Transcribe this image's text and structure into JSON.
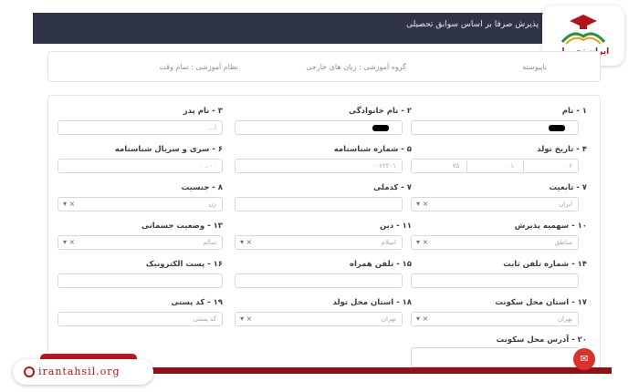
{
  "header": {
    "title": "پذیرش صرفا بر اساس سوابق تحصیلی"
  },
  "logo": {
    "text": "ایران تحصیل"
  },
  "info": {
    "level": "ناپیوسته",
    "group": "گروه آموزشی : زبان های خارجی",
    "system": "نظام آموزشی : تمام وقت"
  },
  "form": {
    "f1": {
      "label": "۱ - نام"
    },
    "f2": {
      "label": "۲ - نام خانوادگی"
    },
    "f3": {
      "label": "۳ - نام پدر",
      "value": "ا..."
    },
    "f4": {
      "label": "۴ - تاریخ تولد",
      "day": "۰۶",
      "month": "۰۱",
      "year": "۷۵"
    },
    "f5": {
      "label": "۵ - شماره شناسنامه",
      "value": "۰۰۶۲۲۰۱"
    },
    "f6": {
      "label": "۶ - سری و سریال شناسنامه",
      "value": "۰۰ ، ۰"
    },
    "f7": {
      "label": "۷ - تابعیت",
      "value": "ایران"
    },
    "f8": {
      "label": "۷ - کدملی"
    },
    "f9": {
      "label": "۸ - جنسیت",
      "value": "زن"
    },
    "f10": {
      "label": "۱۰ - سهمیه پذیرش",
      "value": "مناطق"
    },
    "f11": {
      "label": "۱۱ - دین",
      "value": "اسلام"
    },
    "f12": {
      "label": "۱۳ - وضعیت جسمانی",
      "value": "سالم"
    },
    "f13": {
      "label": "۱۴ - شماره تلفن ثابت"
    },
    "f14": {
      "label": "۱۵ - تلفن همراه"
    },
    "f15": {
      "label": "۱۶ - پست الکترونیک"
    },
    "f16": {
      "label": "۱۷ - استان محل سکونت",
      "value": "تهران"
    },
    "f17": {
      "label": "۱۸ - استان محل تولد",
      "value": "تهران"
    },
    "f18": {
      "label": "۱۹ - کد پستی",
      "value": "کد پستی"
    },
    "f19": {
      "label": "۲۰ - آدرس محل سکونت"
    }
  },
  "footer": {
    "domain": "irantahsil.org"
  },
  "colors": {
    "header_bg": "#2f3447",
    "brand_red": "#b0151b"
  }
}
